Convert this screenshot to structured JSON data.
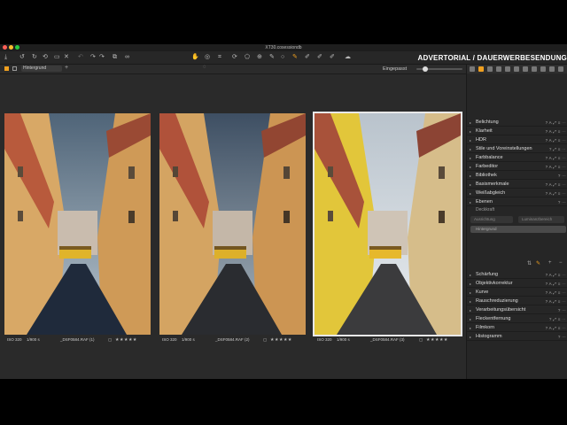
{
  "window": {
    "title": "XT30.cosessiondb"
  },
  "banner": {
    "text": "ADVERTORIAL / DAUERWERBESENDUNG"
  },
  "subbar": {
    "layer_select": "Hintergrund",
    "zoom_label": "Eingepasst",
    "zoom_level": 0.2
  },
  "photos": [
    {
      "iso": "ISO 320",
      "shutter": "1/900 s",
      "filename": "_DSF0584.RAF (1)",
      "stars": "★★★★★",
      "selected": false
    },
    {
      "iso": "ISO 320",
      "shutter": "1/900 s",
      "filename": "_DSF0584.RAF (2)",
      "stars": "★★★★★",
      "selected": false
    },
    {
      "iso": "ISO 320",
      "shutter": "1/900 s",
      "filename": "_DSF0584.RAF (3)",
      "stars": "★★★★★",
      "selected": true
    }
  ],
  "panel": {
    "tools_top": [
      {
        "label": "Belichtung",
        "ctrl": "? A ⤢ ≡ ⋯"
      },
      {
        "label": "Klarheit",
        "ctrl": "? A ⤢ ≡ ⋯"
      },
      {
        "label": "HDR",
        "ctrl": "? A ⤢ ≡ ⋯"
      },
      {
        "label": "Stile und Voreinstellungen",
        "ctrl": "? ⤢ ≡ ⋯"
      },
      {
        "label": "Farbbalance",
        "ctrl": "? A ⤢ ≡ ⋯"
      },
      {
        "label": "Farbeditor",
        "ctrl": "? A ⤢ ≡ ⋯"
      },
      {
        "label": "Bibliothek",
        "ctrl": "? ⋯"
      },
      {
        "label": "Basismerkmale",
        "ctrl": "? A ⤢ ≡ ⋯"
      },
      {
        "label": "Weißabgleich",
        "ctrl": "? A ⤢ ≡ ⋯"
      },
      {
        "label": "Ebenen",
        "ctrl": "? ⋯"
      }
    ],
    "layers_sub": {
      "opacity_label": "Deckkraft",
      "button_a": "Ausrichtung",
      "button_b": "Luminanzbereich",
      "background_item": "Hintergrund"
    },
    "tools_bottom": [
      {
        "label": "Schärfung",
        "ctrl": "? A ⤢ ≡ ⋯"
      },
      {
        "label": "Objektivkorrektur",
        "ctrl": "? A ⤢ ≡ ⋯"
      },
      {
        "label": "Kurve",
        "ctrl": "? A ⤢ ≡ ⋯"
      },
      {
        "label": "Rauschreduzierung",
        "ctrl": "? A ⤢ ≡ ⋯"
      },
      {
        "label": "Verarbeitungsübersicht",
        "ctrl": "? ⋯"
      },
      {
        "label": "Fleckentfernung",
        "ctrl": "? ⤢ ≡ ⋯"
      },
      {
        "label": "Filmkorn",
        "ctrl": "? A ⤢ ≡ ⋯"
      },
      {
        "label": "Histogramm",
        "ctrl": "? ⋯"
      }
    ]
  },
  "colors": {
    "accent": "#f0a020",
    "traffic_red": "#ff5f57",
    "traffic_yellow": "#febc2e",
    "traffic_green": "#28c840"
  }
}
